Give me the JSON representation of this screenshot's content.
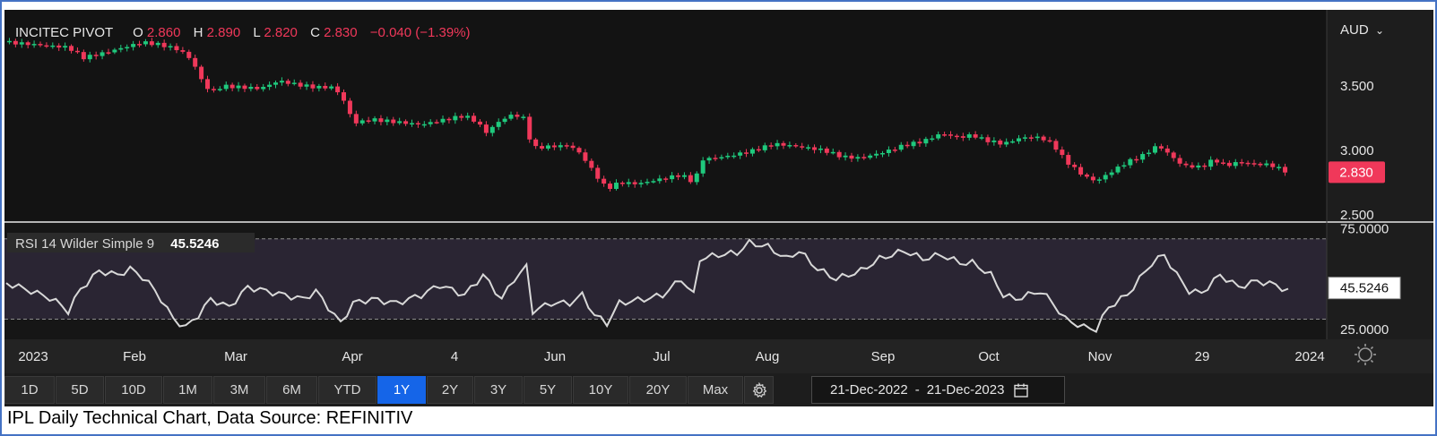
{
  "chart_data": {
    "type": "candlestick",
    "legend": {
      "symbol": "INCITEC PIVOT",
      "open_label": "O",
      "open": "2.860",
      "high_label": "H",
      "high": "2.890",
      "low_label": "L",
      "low": "2.820",
      "close_label": "C",
      "close": "2.830",
      "change": "−0.040 (−1.39%)"
    },
    "currency": "AUD",
    "price_ticks": [
      "3.500",
      "3.000",
      "2.500"
    ],
    "last_price": "2.830",
    "x_labels": [
      "2023",
      "Feb",
      "Mar",
      "Apr",
      "4",
      "Jun",
      "Jul",
      "Aug",
      "Sep",
      "Oct",
      "Nov",
      "29",
      "2024"
    ],
    "price_axis": {
      "min": 2.45,
      "max": 4.05
    },
    "price_path": [
      [
        0,
        3.84
      ],
      [
        10,
        3.82
      ],
      [
        20,
        3.8
      ],
      [
        25,
        3.72
      ],
      [
        32,
        3.76
      ],
      [
        38,
        3.8
      ],
      [
        44,
        3.84
      ],
      [
        50,
        3.82
      ],
      [
        56,
        3.78
      ],
      [
        60,
        3.7
      ],
      [
        63,
        3.55
      ],
      [
        66,
        3.45
      ],
      [
        70,
        3.5
      ],
      [
        76,
        3.49
      ],
      [
        82,
        3.48
      ],
      [
        88,
        3.54
      ],
      [
        94,
        3.51
      ],
      [
        100,
        3.49
      ],
      [
        106,
        3.49
      ],
      [
        110,
        3.35
      ],
      [
        112,
        3.21
      ],
      [
        118,
        3.24
      ],
      [
        126,
        3.22
      ],
      [
        134,
        3.2
      ],
      [
        142,
        3.24
      ],
      [
        148,
        3.27
      ],
      [
        152,
        3.22
      ],
      [
        155,
        3.14
      ],
      [
        160,
        3.24
      ],
      [
        164,
        3.28
      ],
      [
        167,
        3.25
      ],
      [
        170,
        3.02
      ],
      [
        176,
        3.03
      ],
      [
        182,
        3.04
      ],
      [
        186,
        2.96
      ],
      [
        190,
        2.82
      ],
      [
        194,
        2.7
      ],
      [
        198,
        2.75
      ],
      [
        204,
        2.74
      ],
      [
        212,
        2.78
      ],
      [
        218,
        2.81
      ],
      [
        222,
        2.75
      ],
      [
        225,
        2.93
      ],
      [
        232,
        2.95
      ],
      [
        240,
        2.99
      ],
      [
        248,
        3.05
      ],
      [
        256,
        3.03
      ],
      [
        264,
        3.0
      ],
      [
        270,
        2.95
      ],
      [
        276,
        2.94
      ],
      [
        284,
        2.99
      ],
      [
        290,
        3.04
      ],
      [
        296,
        3.07
      ],
      [
        302,
        3.13
      ],
      [
        308,
        3.1
      ],
      [
        312,
        3.12
      ],
      [
        316,
        3.08
      ],
      [
        322,
        3.05
      ],
      [
        328,
        3.1
      ],
      [
        334,
        3.1
      ],
      [
        338,
        3.05
      ],
      [
        342,
        2.92
      ],
      [
        348,
        2.8
      ],
      [
        352,
        2.76
      ],
      [
        356,
        2.82
      ],
      [
        362,
        2.91
      ],
      [
        367,
        2.96
      ],
      [
        372,
        3.04
      ],
      [
        376,
        2.96
      ],
      [
        380,
        2.88
      ],
      [
        386,
        2.87
      ],
      [
        390,
        2.93
      ],
      [
        394,
        2.88
      ],
      [
        398,
        2.91
      ],
      [
        404,
        2.89
      ],
      [
        408,
        2.89
      ],
      [
        412,
        2.85
      ],
      [
        414,
        2.83
      ]
    ],
    "rsi": {
      "label": "RSI 14 Wilder Simple 9",
      "value": "45.5246",
      "ticks": [
        "75.0000",
        "25.0000"
      ],
      "axis": {
        "min": 20,
        "max": 77
      },
      "guides": [
        70,
        30
      ],
      "path": [
        [
          0,
          48
        ],
        [
          8,
          44
        ],
        [
          15,
          40
        ],
        [
          20,
          34
        ],
        [
          24,
          45
        ],
        [
          30,
          54
        ],
        [
          36,
          52
        ],
        [
          40,
          55
        ],
        [
          45,
          50
        ],
        [
          50,
          40
        ],
        [
          54,
          30
        ],
        [
          58,
          26
        ],
        [
          62,
          32
        ],
        [
          66,
          40
        ],
        [
          72,
          36
        ],
        [
          78,
          46
        ],
        [
          84,
          44
        ],
        [
          90,
          42
        ],
        [
          96,
          40
        ],
        [
          100,
          44
        ],
        [
          104,
          36
        ],
        [
          108,
          28
        ],
        [
          112,
          38
        ],
        [
          118,
          40
        ],
        [
          126,
          38
        ],
        [
          134,
          42
        ],
        [
          140,
          47
        ],
        [
          148,
          42
        ],
        [
          154,
          52
        ],
        [
          160,
          40
        ],
        [
          164,
          50
        ],
        [
          168,
          56
        ],
        [
          170,
          34
        ],
        [
          176,
          38
        ],
        [
          182,
          38
        ],
        [
          186,
          42
        ],
        [
          190,
          32
        ],
        [
          194,
          28
        ],
        [
          198,
          38
        ],
        [
          206,
          40
        ],
        [
          212,
          42
        ],
        [
          218,
          50
        ],
        [
          222,
          42
        ],
        [
          224,
          60
        ],
        [
          230,
          62
        ],
        [
          236,
          63
        ],
        [
          240,
          68
        ],
        [
          246,
          66
        ],
        [
          252,
          60
        ],
        [
          256,
          64
        ],
        [
          262,
          55
        ],
        [
          268,
          50
        ],
        [
          276,
          54
        ],
        [
          282,
          60
        ],
        [
          290,
          64
        ],
        [
          296,
          60
        ],
        [
          302,
          62
        ],
        [
          308,
          58
        ],
        [
          312,
          58
        ],
        [
          318,
          52
        ],
        [
          322,
          42
        ],
        [
          326,
          40
        ],
        [
          334,
          44
        ],
        [
          338,
          38
        ],
        [
          342,
          30
        ],
        [
          348,
          26
        ],
        [
          352,
          25
        ],
        [
          356,
          36
        ],
        [
          362,
          42
        ],
        [
          370,
          58
        ],
        [
          374,
          62
        ],
        [
          378,
          52
        ],
        [
          382,
          44
        ],
        [
          386,
          43
        ],
        [
          392,
          52
        ],
        [
          398,
          46
        ],
        [
          404,
          49
        ],
        [
          410,
          47
        ],
        [
          414,
          44
        ]
      ]
    }
  },
  "toolbar": {
    "ranges": [
      "1D",
      "5D",
      "10D",
      "1M",
      "3M",
      "6M",
      "YTD",
      "1Y",
      "2Y",
      "3Y",
      "5Y",
      "10Y",
      "20Y",
      "Max"
    ],
    "active": "1Y",
    "date_from": "21-Dec-2022",
    "date_sep": "-",
    "date_to": "21-Dec-2023"
  },
  "colors": {
    "up": "#1fc97d",
    "down": "#f0385a",
    "rsi_line": "#d8d8d8",
    "accent": "#1565e8",
    "last_price_bg": "#f0385a"
  },
  "caption": "IPL Daily Technical Chart, Data Source: REFINITIV"
}
